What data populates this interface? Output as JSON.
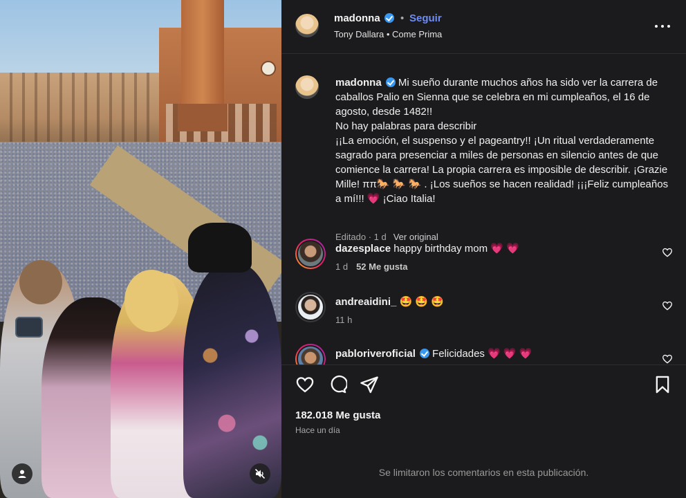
{
  "header": {
    "username": "madonna",
    "separator": "•",
    "follow_label": "Seguir",
    "audio": "Tony Dallara • Come Prima"
  },
  "caption": {
    "username": "madonna",
    "lines": [
      "Mi sueño durante muchos años ha sido ver la carrera de caballos Palio en Sienna que se celebra en mi cumpleaños, el 16 de agosto, desde 1482!!",
      "No hay palabras para describir",
      "¡¡La emoción, el suspenso y el pageantry!! ¡Un ritual verdaderamente sagrado para presenciar a miles de personas en silencio antes de que comience la carrera! La propia carrera es imposible de describir. ¡Grazie Mille! ππ🐎 🐎 🐎 . ¡Los sueños se hacen realidad! ¡¡¡Feliz cumpleaños a mí!!! 💗 ¡Ciao Italia!"
    ],
    "edited": "Editado · 1 d",
    "see_original": "Ver original"
  },
  "comments": [
    {
      "username": "dazesplace",
      "text": "happy birthday mom 💗 💗",
      "time": "1 d",
      "likes": "52 Me gusta"
    },
    {
      "username": "andreaidini_",
      "text": "🤩 🤩 🤩",
      "time": "11 h",
      "likes": ""
    },
    {
      "username": "pabloriveroficial",
      "text": "Felicidades 💗 💗 💗",
      "time": "",
      "likes": ""
    }
  ],
  "footer": {
    "likes": "182.018 Me gusta",
    "posted": "Hace un día",
    "comments_limited": "Se limitaron los comentarios en esta publicación."
  },
  "colors": {
    "background": "#1b1b1d",
    "follow": "#6d8cf5",
    "verified": "#3897f0",
    "heart": "#ff3d6e"
  },
  "icons": [
    "more-options-icon",
    "verified-badge-icon",
    "heart-icon",
    "comment-icon",
    "share-icon",
    "bookmark-icon",
    "user-tag-icon",
    "mute-icon"
  ]
}
